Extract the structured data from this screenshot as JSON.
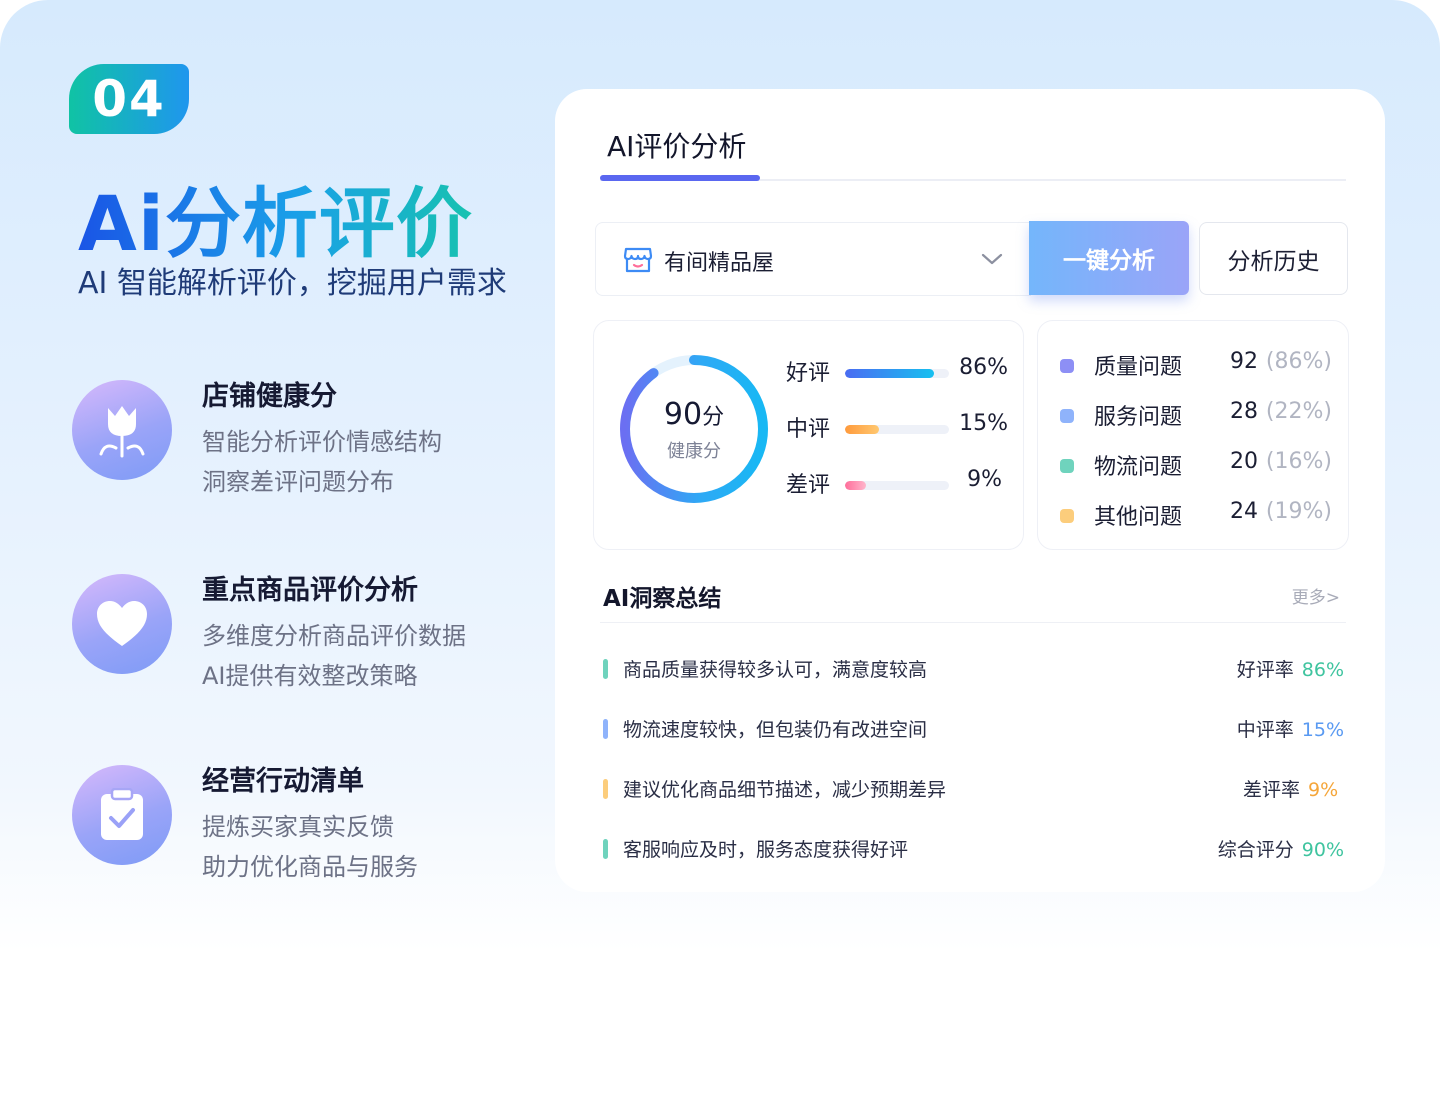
{
  "hero": {
    "badge": "04",
    "title": "Ai分析评价",
    "subtitle": "AI 智能解析评价，挖掘用户需求"
  },
  "features": [
    {
      "icon": "tulip-icon",
      "title": "店铺健康分",
      "lines": [
        "智能分析评价情感结构",
        "洞察差评问题分布"
      ]
    },
    {
      "icon": "heart-icon",
      "title": "重点商品评价分析",
      "lines": [
        "多维度分析商品评价数据",
        "AI提供有效整改策略"
      ]
    },
    {
      "icon": "clipboard-check-icon",
      "title": "经营行动清单",
      "lines": [
        "提炼买家真实反馈",
        "助力优化商品与服务"
      ]
    }
  ],
  "card": {
    "tab_active": "AI评价分析",
    "shop": {
      "icon": "store-icon",
      "name": "有间精品屋",
      "chevron": "chevron-down-icon"
    },
    "btn_analyze": "一键分析",
    "btn_history": "分析历史",
    "score": {
      "value": "90",
      "unit": "分",
      "label": "健康分",
      "fraction": 0.9
    },
    "ratings": [
      {
        "label": "好评",
        "value": "86%",
        "fraction": 0.86,
        "color_from": "#4a6cf2",
        "color_to": "#17c0f0"
      },
      {
        "label": "中评",
        "value": "15%",
        "fraction": 0.33,
        "color_from": "#ff9a3c",
        "color_to": "#ffc870"
      },
      {
        "label": "差评",
        "value": "9%",
        "fraction": 0.2,
        "color_from": "#ff6e9a",
        "color_to": "#ffb6cc"
      }
    ],
    "issues": [
      {
        "name": "质量问题",
        "count": "92",
        "pct": "(86%)",
        "color": "#8d8ff5"
      },
      {
        "name": "服务问题",
        "count": "28",
        "pct": "(22%)",
        "color": "#8fb3fb"
      },
      {
        "name": "物流问题",
        "count": "20",
        "pct": "(16%)",
        "color": "#6fd3bd"
      },
      {
        "name": "其他问题",
        "count": "24",
        "pct": "(19%)",
        "color": "#fccd7c"
      }
    ],
    "insight": {
      "title": "AI洞察总结",
      "more": "更多>",
      "rows": [
        {
          "text": "商品质量获得较多认可，满意度较高",
          "metric": "好评率",
          "value": "86%",
          "bar_color": "#6fd3bd",
          "value_color": "#3fc49f"
        },
        {
          "text": "物流速度较快，但包装仍有改进空间",
          "metric": "中评率",
          "value": "15%",
          "bar_color": "#8fb3fb",
          "value_color": "#5a9af2"
        },
        {
          "text": "建议优化商品细节描述，减少预期差异",
          "metric": "差评率",
          "value": "9%",
          "bar_color": "#fccd7c",
          "value_color": "#f5a63a"
        },
        {
          "text": "客服响应及时，服务态度获得好评",
          "metric": "综合评分",
          "value": "90%",
          "bar_color": "#6fd3bd",
          "value_color": "#3fc49f"
        }
      ]
    }
  }
}
